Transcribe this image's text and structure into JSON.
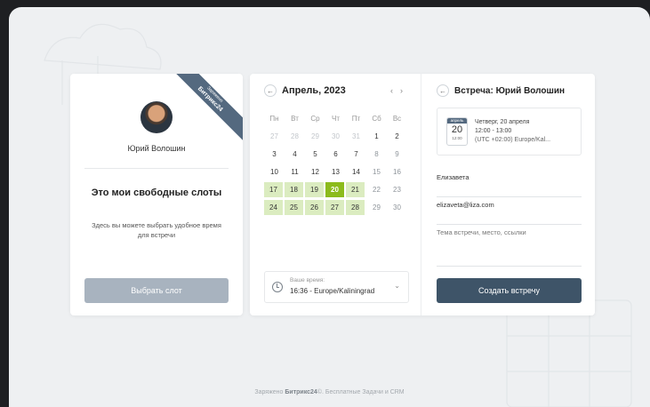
{
  "profile": {
    "name": "Юрий Волошин",
    "title": "Это мои свободные слоты",
    "description": "Здесь вы можете выбрать удобное время для встречи",
    "button": "Выбрать слот",
    "ribbon_top": "Заряжено",
    "ribbon_brand": "Битрикс24"
  },
  "calendar": {
    "month": "Апрель, 2023",
    "prev_icon": "arrow-left-icon",
    "weekdays": [
      "Пн",
      "Вт",
      "Ср",
      "Чт",
      "Пт",
      "Сб",
      "Вс"
    ],
    "days": [
      {
        "d": "27",
        "s": "muted"
      },
      {
        "d": "28",
        "s": "muted"
      },
      {
        "d": "29",
        "s": "muted"
      },
      {
        "d": "30",
        "s": "muted"
      },
      {
        "d": "31",
        "s": "muted"
      },
      {
        "d": "1",
        "s": "normal"
      },
      {
        "d": "2",
        "s": "normal"
      },
      {
        "d": "3",
        "s": "normal"
      },
      {
        "d": "4",
        "s": "normal"
      },
      {
        "d": "5",
        "s": "normal"
      },
      {
        "d": "6",
        "s": "normal"
      },
      {
        "d": "7",
        "s": "normal"
      },
      {
        "d": "8",
        "s": "weekend"
      },
      {
        "d": "9",
        "s": "weekend"
      },
      {
        "d": "10",
        "s": "normal"
      },
      {
        "d": "11",
        "s": "normal"
      },
      {
        "d": "12",
        "s": "normal"
      },
      {
        "d": "13",
        "s": "normal"
      },
      {
        "d": "14",
        "s": "normal"
      },
      {
        "d": "15",
        "s": "weekend"
      },
      {
        "d": "16",
        "s": "weekend"
      },
      {
        "d": "17",
        "s": "avail"
      },
      {
        "d": "18",
        "s": "avail"
      },
      {
        "d": "19",
        "s": "avail"
      },
      {
        "d": "20",
        "s": "selected"
      },
      {
        "d": "21",
        "s": "avail"
      },
      {
        "d": "22",
        "s": "weekend"
      },
      {
        "d": "23",
        "s": "weekend"
      },
      {
        "d": "24",
        "s": "avail"
      },
      {
        "d": "25",
        "s": "avail"
      },
      {
        "d": "26",
        "s": "avail"
      },
      {
        "d": "27",
        "s": "avail"
      },
      {
        "d": "28",
        "s": "avail"
      },
      {
        "d": "29",
        "s": "weekend"
      },
      {
        "d": "30",
        "s": "weekend"
      }
    ],
    "timezone_label": "Ваше время:",
    "timezone_value": "16:36 - Europe/Kaliningrad"
  },
  "form": {
    "title": "Встреча: Юрий Волошин",
    "event_month": "апрель",
    "event_day": "20",
    "event_time_short": "12:00",
    "event_date": "Четверг, 20 апреля",
    "event_time": "12:00 - 13:00",
    "event_tz": "(UTC +02:00) Europe/Kal...",
    "name_value": "Елизавета",
    "email_value": "elizaveta@liza.com",
    "topic_placeholder": "Тема встречи, место, ссылки",
    "submit": "Создать встречу"
  },
  "footer": {
    "prefix": "Заряжено",
    "brand": "Битрикс24",
    "suffix": "©. Бесплатные Задачи и CRM"
  },
  "colors": {
    "selected_day": "#8cbb1c",
    "available_day": "#dbecc0",
    "primary_button": "#3e5468",
    "disabled_button": "#a8b3bf"
  }
}
